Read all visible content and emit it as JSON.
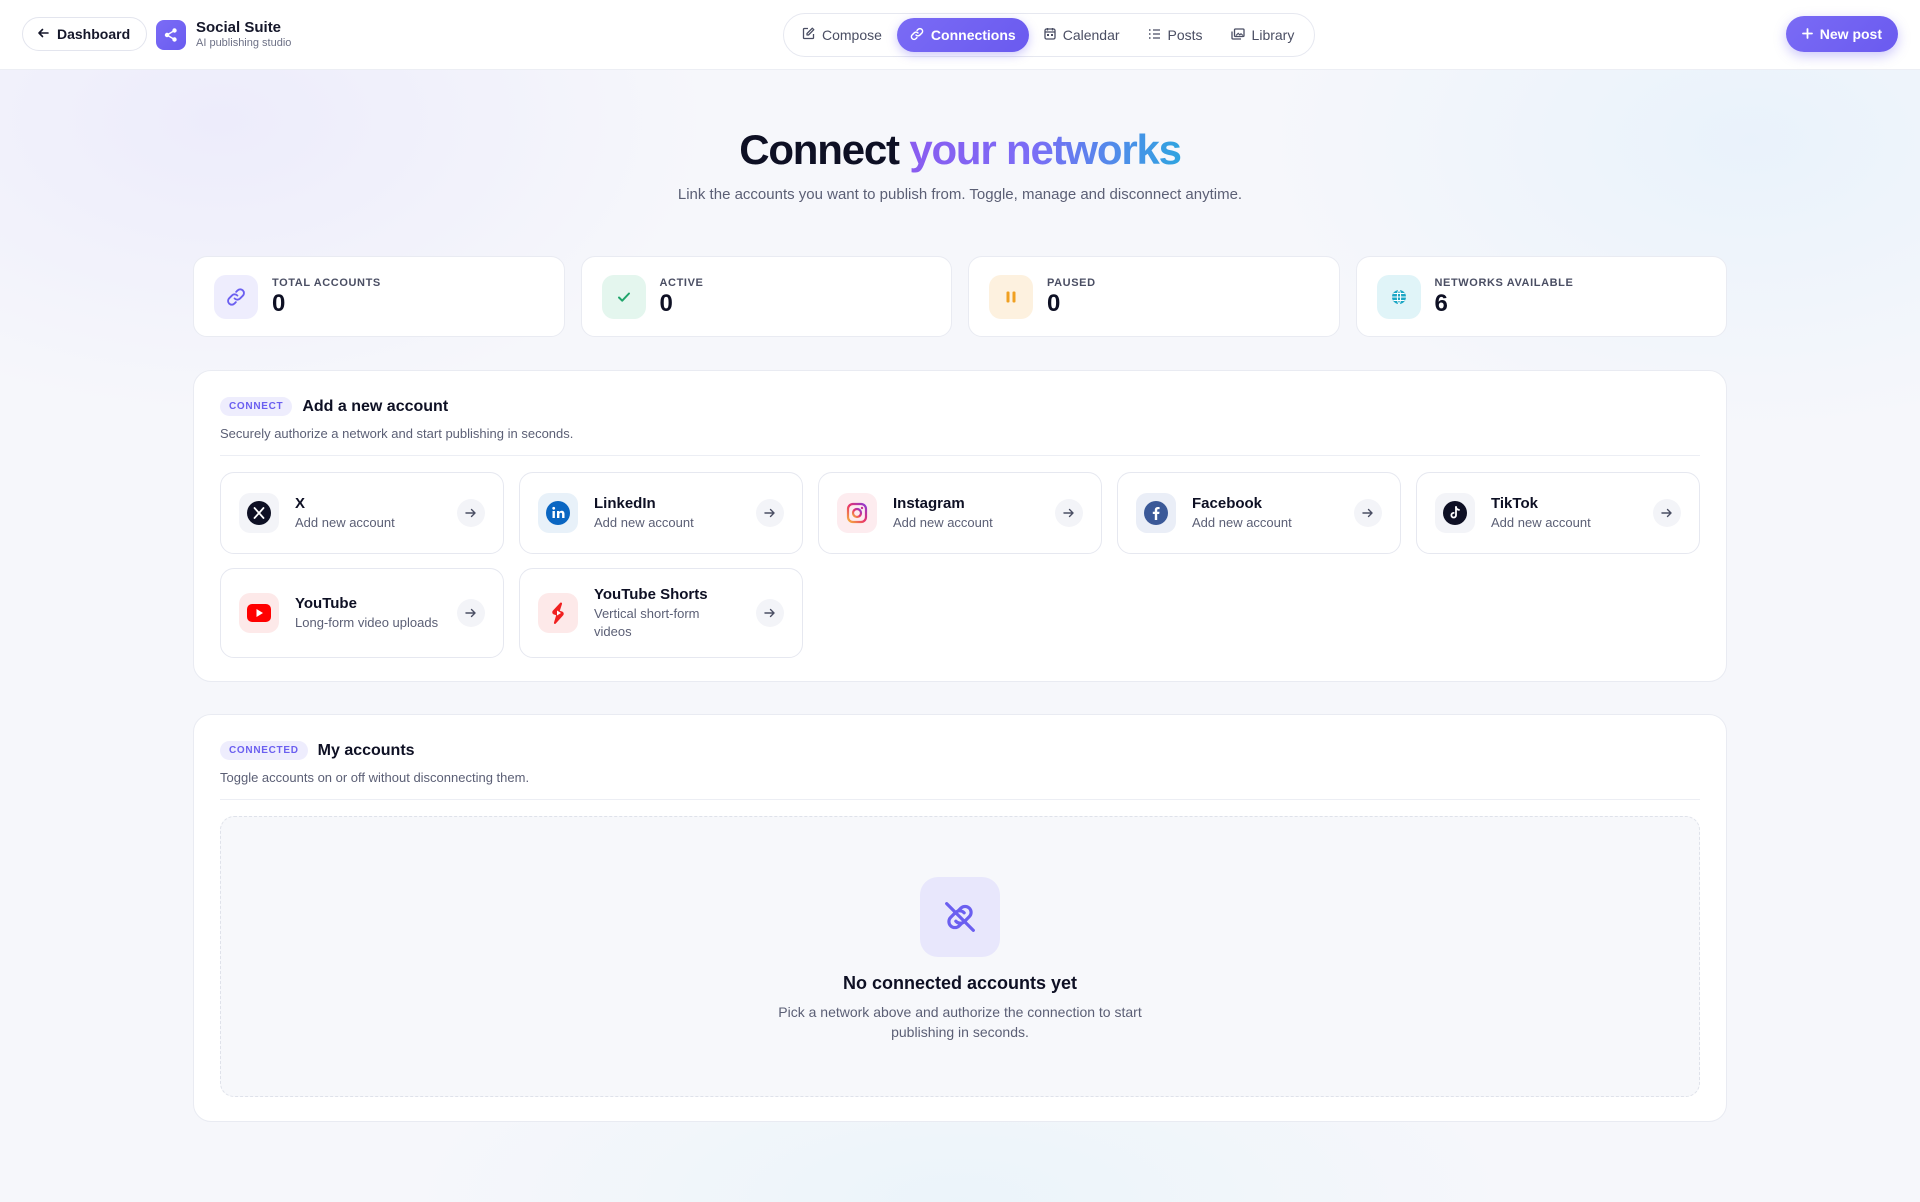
{
  "topbar": {
    "back_label": "Dashboard",
    "brand_title": "Social Suite",
    "brand_subtitle": "AI publishing studio",
    "nav": [
      {
        "label": "Compose",
        "icon": "edit-icon",
        "active": false
      },
      {
        "label": "Connections",
        "icon": "link-icon",
        "active": true
      },
      {
        "label": "Calendar",
        "icon": "calendar-icon",
        "active": false
      },
      {
        "label": "Posts",
        "icon": "list-icon",
        "active": false
      },
      {
        "label": "Library",
        "icon": "gallery-icon",
        "active": false
      }
    ],
    "new_post_label": "New post"
  },
  "hero": {
    "title_plain": "Connect",
    "title_gradient": "your networks",
    "subtitle": "Link the accounts you want to publish from. Toggle, manage and disconnect anytime."
  },
  "stats": [
    {
      "label": "TOTAL ACCOUNTS",
      "value": "0",
      "icon": "link-icon",
      "color": "#6b5ff0"
    },
    {
      "label": "ACTIVE",
      "value": "0",
      "icon": "check-icon",
      "color": "#1fa56b"
    },
    {
      "label": "PAUSED",
      "value": "0",
      "icon": "pause-icon",
      "color": "#f0a020"
    },
    {
      "label": "NETWORKS AVAILABLE",
      "value": "6",
      "icon": "globe-icon",
      "color": "#1aa6c4"
    }
  ],
  "connect_panel": {
    "tag": "CONNECT",
    "title": "Add a new account",
    "subtitle": "Securely authorize a network and start publishing in seconds.",
    "networks": [
      {
        "name": "X",
        "desc": "Add new account",
        "icon": "x-icon"
      },
      {
        "name": "LinkedIn",
        "desc": "Add new account",
        "icon": "linkedin-icon"
      },
      {
        "name": "Instagram",
        "desc": "Add new account",
        "icon": "instagram-icon"
      },
      {
        "name": "Facebook",
        "desc": "Add new account",
        "icon": "facebook-icon"
      },
      {
        "name": "TikTok",
        "desc": "Add new account",
        "icon": "tiktok-icon"
      },
      {
        "name": "YouTube",
        "desc": "Long-form video uploads",
        "icon": "youtube-icon"
      },
      {
        "name": "YouTube Shorts",
        "desc": "Vertical short-form videos",
        "icon": "youtube-shorts-icon"
      }
    ]
  },
  "accounts_panel": {
    "tag": "CONNECTED",
    "title": "My accounts",
    "subtitle": "Toggle accounts on or off without disconnecting them.",
    "empty_title": "No connected accounts yet",
    "empty_desc": "Pick a network above and authorize the connection to start publishing in seconds."
  }
}
